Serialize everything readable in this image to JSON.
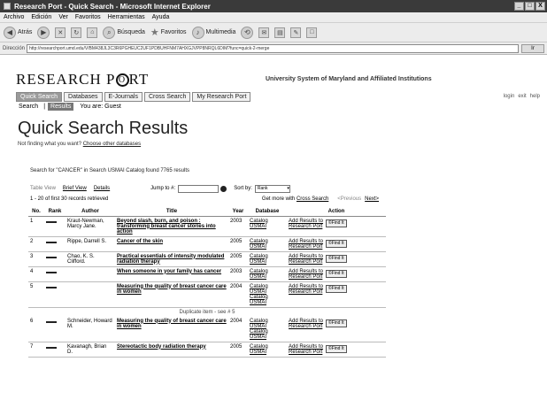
{
  "window": {
    "title": "Research Port - Quick Search - Microsoft Internet Explorer",
    "controls": [
      "_",
      "□",
      "X"
    ]
  },
  "menu": [
    "Archivo",
    "Edición",
    "Ver",
    "Favoritos",
    "Herramientas",
    "Ayuda"
  ],
  "toolbar": {
    "back": "Atrás",
    "search": "Búsqueda",
    "favorites": "Favoritos",
    "multimedia": "Multimedia"
  },
  "address": {
    "label": "Dirección",
    "url": "http://researchport.umd.edu/V/BM438JL3C3R6PGHEUC2UF1PDBUHFNM7AHXGJVPP8NRQL6DIM?func=quick-2-merge",
    "go": "Ir"
  },
  "header": {
    "logo": "RESEARCH P",
    "logo_o": "O",
    "logo_rt": "RT",
    "institution": "University System of Maryland and Affiliated Institutions",
    "tabs": [
      "Quick Search",
      "Databases",
      "E-Journals",
      "Cross Search",
      "My Research Port"
    ],
    "util_links": [
      "login",
      "exit",
      "help"
    ],
    "subnav": [
      "Search",
      "Results"
    ],
    "you_are": "You are: Guest"
  },
  "page_title": "Quick Search Results",
  "not_finding": {
    "text": "Not finding what you want? ",
    "link": "Choose other databases"
  },
  "summary": "Search for \"CANCER\" in Search USMAI Catalog found 7765 results",
  "viewbar": {
    "table_view": "Table View",
    "brief_view": "Brief View",
    "details": "Details",
    "jump": "Jump to #:",
    "sort_by": "Sort by:",
    "sort_value": "Rank"
  },
  "countbar": {
    "records": "1 - 20 of first 30 records retrieved",
    "cross_prefix": "Get more with ",
    "cross_link": "Cross Search",
    "previous": "<Previous",
    "next": "Next>"
  },
  "table": {
    "headers": [
      "No.",
      "Rank",
      "Author",
      "Title",
      "Year",
      "Database",
      "Action"
    ],
    "add_line1": "Add Results to",
    "add_line2": "Research Port",
    "findit": "©Find It"
  },
  "rows": [
    {
      "no": "1",
      "author": "Kraut-Newman, Marcy Jane.",
      "title": "Beyond slash, burn, and poison : transforming breast cancer stories into action",
      "year": "2003",
      "db": [
        "Catalog",
        "USMAI"
      ]
    },
    {
      "no": "2",
      "author": "Rippe, Darrell S.",
      "title": "Cancer of the skin",
      "year": "2005",
      "db": [
        "Catalog",
        "USMAI"
      ]
    },
    {
      "no": "3",
      "author": "Chao, K. S. Clifford.",
      "title": "Practical essentials of intensity modulated radiation therapy",
      "year": "2005",
      "db": [
        "Catalog",
        "USMAI"
      ]
    },
    {
      "no": "4",
      "author": "",
      "title": "When someone in your family has cancer",
      "year": "2003",
      "db": [
        "Catalog",
        "USMAI"
      ]
    },
    {
      "no": "5",
      "author": "",
      "title": "Measuring the quality of breast cancer care in women",
      "year": "2004",
      "db": [
        "Catalog",
        "USMAI",
        "Catalog",
        "USMAI"
      ]
    },
    {
      "no": "6",
      "author": "Schneider, Howard M.",
      "title": "Measuring the quality of breast cancer care in women",
      "year": "2004",
      "db": [
        "Catalog",
        "USMAI",
        "Catalog",
        "USMAI"
      ],
      "dup": "Duplicate item - see # 5"
    },
    {
      "no": "7",
      "author": "Kavanagh, Brian D.",
      "title": "Stereotactic body radiation therapy",
      "year": "2005",
      "db": [
        "Catalog",
        "USMAI"
      ]
    }
  ]
}
